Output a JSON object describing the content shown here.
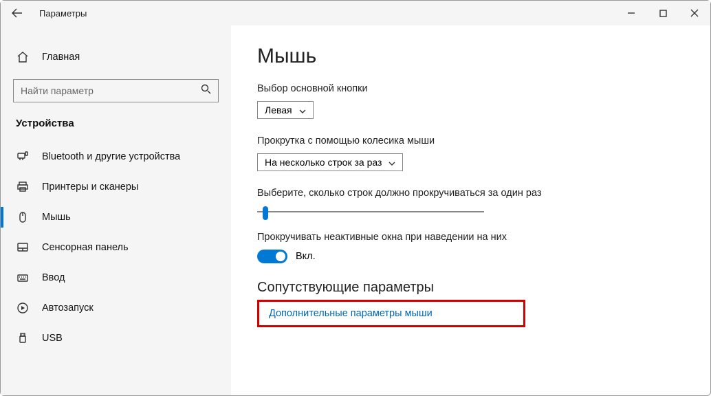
{
  "window": {
    "title": "Параметры"
  },
  "sidebar": {
    "home": "Главная",
    "searchPlaceholder": "Найти параметр",
    "category": "Устройства",
    "items": [
      {
        "label": "Bluetooth и другие устройства",
        "icon": "bluetooth"
      },
      {
        "label": "Принтеры и сканеры",
        "icon": "printer"
      },
      {
        "label": "Мышь",
        "icon": "mouse",
        "active": true
      },
      {
        "label": "Сенсорная панель",
        "icon": "touchpad"
      },
      {
        "label": "Ввод",
        "icon": "keyboard"
      },
      {
        "label": "Автозапуск",
        "icon": "autoplay"
      },
      {
        "label": "USB",
        "icon": "usb"
      }
    ]
  },
  "main": {
    "title": "Мышь",
    "primaryBtnLabel": "Выбор основной кнопки",
    "primaryBtnValue": "Левая",
    "scrollWheelLabel": "Прокрутка с помощью колесика мыши",
    "scrollWheelValue": "На несколько строк за раз",
    "linesLabel": "Выберите, сколько строк должно прокручиваться за один раз",
    "inactiveLabel": "Прокручивать неактивные окна при наведении на них",
    "toggleState": "Вкл.",
    "relatedTitle": "Сопутствующие параметры",
    "relatedLink": "Дополнительные параметры мыши"
  }
}
